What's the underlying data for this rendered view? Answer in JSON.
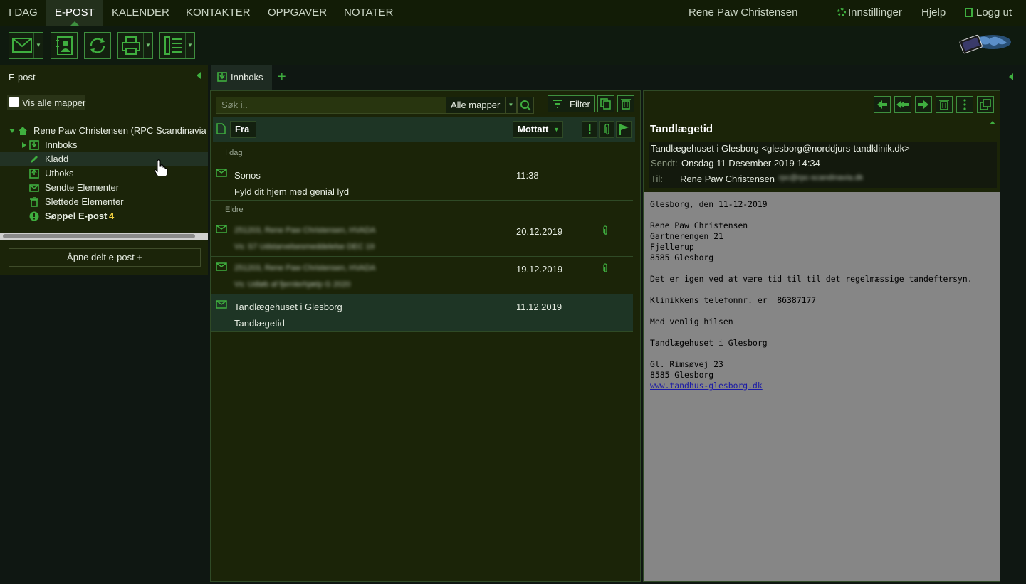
{
  "topnav": {
    "tabs": [
      "I DAG",
      "E-POST",
      "KALENDER",
      "KONTAKTER",
      "OPPGAVER",
      "NOTATER"
    ],
    "active": "E-POST",
    "user_name": "Rene Paw Christensen",
    "settings": "Innstillinger",
    "help": "Hjelp",
    "logout": "Logg ut"
  },
  "toolbar": {
    "buttons": [
      "new-mail-icon",
      "address-book-icon",
      "refresh-icon",
      "print-icon",
      "view-layout-icon"
    ]
  },
  "left_panel": {
    "title": "E-post",
    "show_all_folders": "Vis alle mapper",
    "account": "Rene Paw Christensen (RPC Scandinavia",
    "folders": {
      "inbox": "Innboks",
      "drafts": "Kladd",
      "outbox": "Utboks",
      "sent": "Sendte Elementer",
      "deleted": "Slettede Elementer",
      "junk": "Søppel E-post",
      "junk_count": "4"
    },
    "open_shared": "Åpne delt e-post +"
  },
  "tabs": {
    "inbox": "Innboks",
    "add": "+"
  },
  "list": {
    "search_placeholder": "Søk i..",
    "scope": "Alle mapper",
    "filter": "Filter",
    "col_from": "Fra",
    "col_received": "Mottatt",
    "group_today": "I dag",
    "group_older": "Eldre",
    "messages": [
      {
        "from": "Sonos",
        "subject": "Fyld dit hjem med genial lyd",
        "date": "11:38",
        "attachment": false,
        "blurred": false
      },
      {
        "from": "251203, Rene Paw Christensen, HVADA",
        "subject": "Vs: S7 Udstarvelsesmeddelelse DEC 19",
        "date": "20.12.2019",
        "attachment": true,
        "blurred": true
      },
      {
        "from": "251203, Rene Paw Christensen, HVADA",
        "subject": "Vs: Udløb af fjernlerhjælp G 2020",
        "date": "19.12.2019",
        "attachment": true,
        "blurred": true
      },
      {
        "from": "Tandlægehuset i Glesborg",
        "subject": "Tandlægetid",
        "date": "11.12.2019",
        "attachment": false,
        "blurred": false
      }
    ]
  },
  "reading": {
    "subject": "Tandlægetid",
    "from": "Tandlægehuset i Glesborg <glesborg@norddjurs-tandklinik.dk>",
    "sent_label": "Sendt:",
    "sent_value": "Onsdag 11 Desember 2019 14:34",
    "to_label": "Til:",
    "to_value": "Rene Paw Christensen",
    "to_address": "rpc@rpc-scandinavia.dk",
    "body": {
      "line1": "Glesborg, den 11-12-2019",
      "line2": "Rene Paw Christensen",
      "line3": "Gartnerengen 21",
      "line4": "Fjellerup",
      "line5": "8585 Glesborg",
      "line6": "Det er igen ved at være tid til til det regelmæssige tandeftersyn.",
      "line7": "Klinikkens telefonnr. er  86387177",
      "line8": "Med venlig hilsen",
      "line9": "Tandlægehuset i Glesborg",
      "line10": "Gl. Rimsøvej 23",
      "line11": "8585 Glesborg",
      "link": "www.tandhus-glesborg.dk"
    }
  },
  "colors": {
    "accent": "#3fae3f",
    "topnav_bg": "#121c06",
    "panel_bg": "#1b2408",
    "selection_bg": "#1e3525"
  }
}
